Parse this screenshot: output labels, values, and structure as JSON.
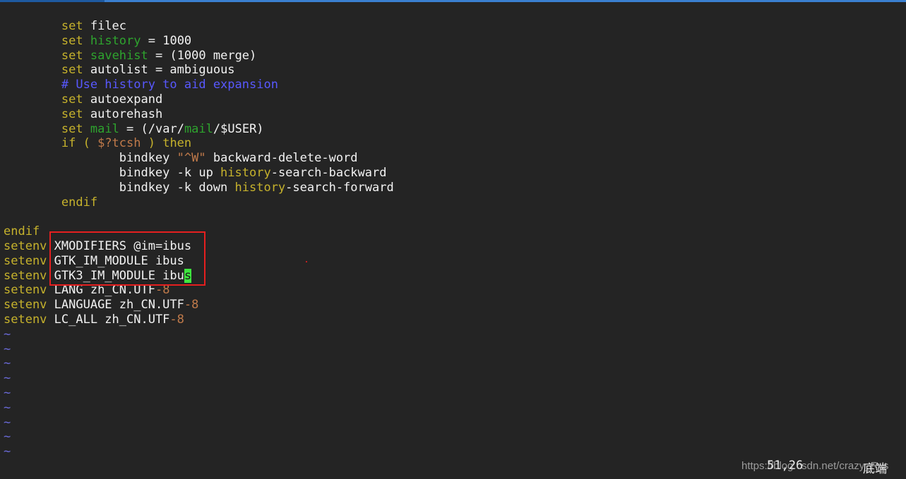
{
  "editor": {
    "lines": [
      [
        {
          "t": "        "
        },
        {
          "t": "set",
          "c": "kw"
        },
        {
          "t": " filec"
        }
      ],
      [
        {
          "t": "        "
        },
        {
          "t": "set",
          "c": "kw"
        },
        {
          "t": " "
        },
        {
          "t": "history",
          "c": "var"
        },
        {
          "t": " = 1000"
        }
      ],
      [
        {
          "t": "        "
        },
        {
          "t": "set",
          "c": "kw"
        },
        {
          "t": " "
        },
        {
          "t": "savehist",
          "c": "var"
        },
        {
          "t": " = (1000 merge)"
        }
      ],
      [
        {
          "t": "        "
        },
        {
          "t": "set",
          "c": "kw"
        },
        {
          "t": " autolist = ambiguous"
        }
      ],
      [
        {
          "t": "        "
        },
        {
          "t": "# Use history to aid expansion",
          "c": "cm"
        }
      ],
      [
        {
          "t": "        "
        },
        {
          "t": "set",
          "c": "kw"
        },
        {
          "t": " autoexpand"
        }
      ],
      [
        {
          "t": "        "
        },
        {
          "t": "set",
          "c": "kw"
        },
        {
          "t": " autorehash"
        }
      ],
      [
        {
          "t": "        "
        },
        {
          "t": "set",
          "c": "kw"
        },
        {
          "t": " "
        },
        {
          "t": "mail",
          "c": "var"
        },
        {
          "t": " = (/var/"
        },
        {
          "t": "mail",
          "c": "var"
        },
        {
          "t": "/$USER)"
        }
      ],
      [
        {
          "t": "        "
        },
        {
          "t": "if ( ",
          "c": "kw"
        },
        {
          "t": "$?tcsh",
          "c": "str"
        },
        {
          "t": " ) then",
          "c": "kw"
        }
      ],
      [
        {
          "t": "                bindkey "
        },
        {
          "t": "\"^W\"",
          "c": "str"
        },
        {
          "t": " backward-delete-word"
        }
      ],
      [
        {
          "t": "                bindkey -k up "
        },
        {
          "t": "history",
          "c": "kw"
        },
        {
          "t": "-search-backward"
        }
      ],
      [
        {
          "t": "                bindkey -k down "
        },
        {
          "t": "history",
          "c": "kw"
        },
        {
          "t": "-search-forward"
        }
      ],
      [
        {
          "t": "        "
        },
        {
          "t": "endif",
          "c": "kw"
        }
      ],
      [
        {
          "t": ""
        }
      ],
      [
        {
          "t": "endif",
          "c": "kw"
        }
      ],
      [
        {
          "t": "setenv",
          "c": "kw"
        },
        {
          "t": " XMODIFIERS @im=ibus"
        }
      ],
      [
        {
          "t": "setenv",
          "c": "kw"
        },
        {
          "t": " GTK_IM_MODULE ibus"
        }
      ],
      [
        {
          "t": "setenv",
          "c": "kw"
        },
        {
          "t": " GTK3_IM_MODULE ibu"
        },
        {
          "t": "s",
          "c": "cursor"
        }
      ],
      [
        {
          "t": "setenv",
          "c": "kw"
        },
        {
          "t": " LANG zh_CN.UTF"
        },
        {
          "t": "-8",
          "c": "num"
        }
      ],
      [
        {
          "t": "setenv",
          "c": "kw"
        },
        {
          "t": " LANGUAGE zh_CN.UTF"
        },
        {
          "t": "-8",
          "c": "num"
        }
      ],
      [
        {
          "t": "setenv",
          "c": "kw"
        },
        {
          "t": " LC_ALL zh_CN.UTF"
        },
        {
          "t": "-8",
          "c": "num"
        }
      ],
      [
        {
          "t": "~",
          "c": "tilde"
        }
      ],
      [
        {
          "t": "~",
          "c": "tilde"
        }
      ],
      [
        {
          "t": "~",
          "c": "tilde"
        }
      ],
      [
        {
          "t": "~",
          "c": "tilde"
        }
      ],
      [
        {
          "t": "~",
          "c": "tilde"
        }
      ],
      [
        {
          "t": "~",
          "c": "tilde"
        }
      ],
      [
        {
          "t": "~",
          "c": "tilde"
        }
      ],
      [
        {
          "t": "~",
          "c": "tilde"
        }
      ],
      [
        {
          "t": "~",
          "c": "tilde"
        }
      ]
    ]
  },
  "status": {
    "position": "51,26",
    "mode": "底端"
  },
  "watermark": "https://blog.csdn.net/crazy_Rys",
  "colors": {
    "background": "#242424",
    "keyword": "#c6b22c",
    "variable": "#2ea42e",
    "comment": "#5858ff",
    "string": "#c07a4a",
    "cursor": "#3ee63e",
    "highlight_box": "#e51f1f"
  }
}
